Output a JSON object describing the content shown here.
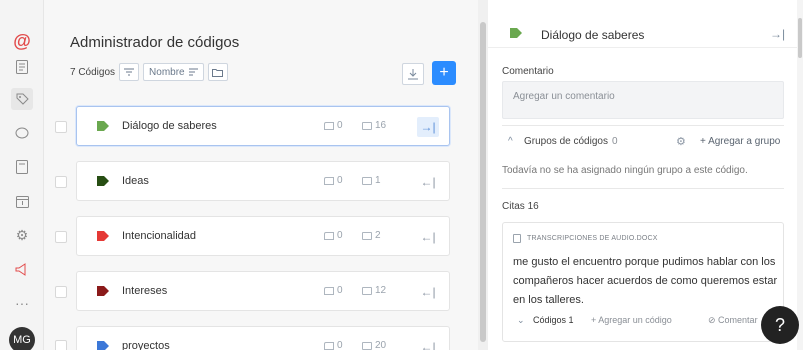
{
  "rail": {
    "items": [
      "logo-icon",
      "document-list-icon",
      "tag-icon",
      "comment-icon",
      "document-icon",
      "calendar-icon",
      "settings-icon",
      "megaphone-icon",
      "more-icon"
    ],
    "avatar": "MG"
  },
  "center": {
    "title": "Administrador de códigos",
    "count_label": "7 Códigos",
    "sort_label": "Nombre",
    "codes": [
      {
        "name": "Diálogo de saberes",
        "color": "#6aa84f",
        "groups": "0",
        "citations": "16",
        "selected": true
      },
      {
        "name": "Ideas",
        "color": "#274e13",
        "groups": "0",
        "citations": "1",
        "selected": false
      },
      {
        "name": "Intencionalidad",
        "color": "#e53935",
        "groups": "0",
        "citations": "2",
        "selected": false
      },
      {
        "name": "Intereses",
        "color": "#8b1a1a",
        "groups": "0",
        "citations": "12",
        "selected": false
      },
      {
        "name": "proyectos",
        "color": "#3c78d8",
        "groups": "0",
        "citations": "20",
        "selected": false
      }
    ]
  },
  "detail": {
    "title": "Diálogo de saberes",
    "tag_color": "#6aa84f",
    "comment_label": "Comentario",
    "comment_placeholder": "Agregar un comentario",
    "groups_label": "Grupos de códigos",
    "groups_count": "0",
    "add_group": "Agregar a grupo",
    "no_group_note": "Todavía no se ha asignado ningún grupo a este código.",
    "citas_label": "Citas",
    "citas_count": "16",
    "citation": {
      "source": "TRANSCRIPCIONES DE AUDIO.DOCX",
      "text": "me gusto el encuentro porque pudimos hablar con los compañeros hacer acuerdos de como queremos estar en los talleres.",
      "codes_label": "Códigos",
      "codes_count": "1",
      "add_code": "Agregar un código",
      "comment": "Comentar"
    }
  },
  "help_label": "?"
}
